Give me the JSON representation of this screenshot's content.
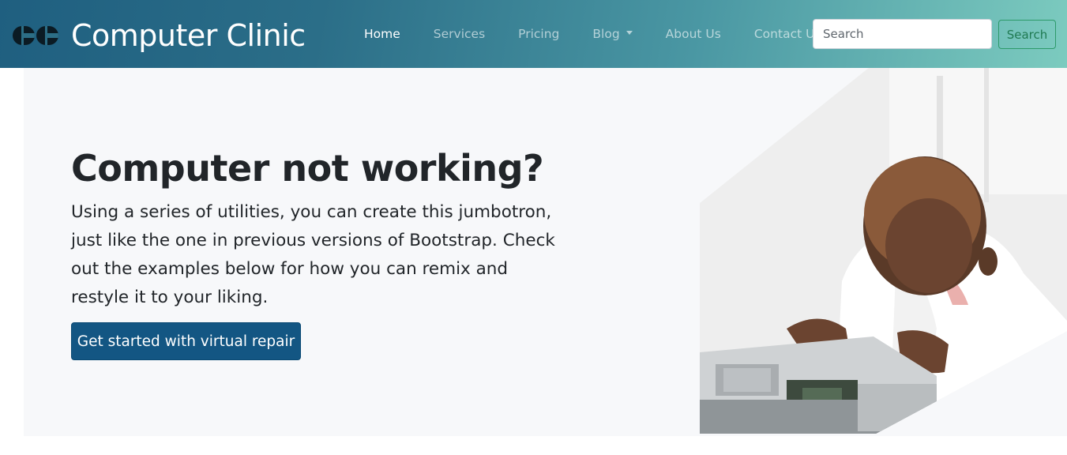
{
  "brand": {
    "name": "Computer Clinic",
    "logo_icon": "cc-logo-icon"
  },
  "nav": {
    "items": [
      {
        "label": "Home",
        "active": true
      },
      {
        "label": "Services",
        "active": false
      },
      {
        "label": "Pricing",
        "active": false
      },
      {
        "label": "Blog",
        "active": false,
        "dropdown": true
      },
      {
        "label": "About Us",
        "active": false
      },
      {
        "label": "Contact Us",
        "active": false
      }
    ]
  },
  "search": {
    "placeholder": "Search",
    "value": "",
    "button_label": "Search"
  },
  "hero": {
    "title": "Computer not working?",
    "lead": "Using a series of utilities, you can create this jumbotron, just like the one in previous versions of Bootstrap. Check out the examples below for how you can remix and restyle it to your liking.",
    "cta_label": "Get started with virtual repair"
  },
  "colors": {
    "navbar_start": "#1f5f80",
    "navbar_end": "#7ccbbf",
    "cta_bg": "#135683",
    "search_btn": "#2d9a6a",
    "jumbotron_bg": "#f7f8fa"
  }
}
